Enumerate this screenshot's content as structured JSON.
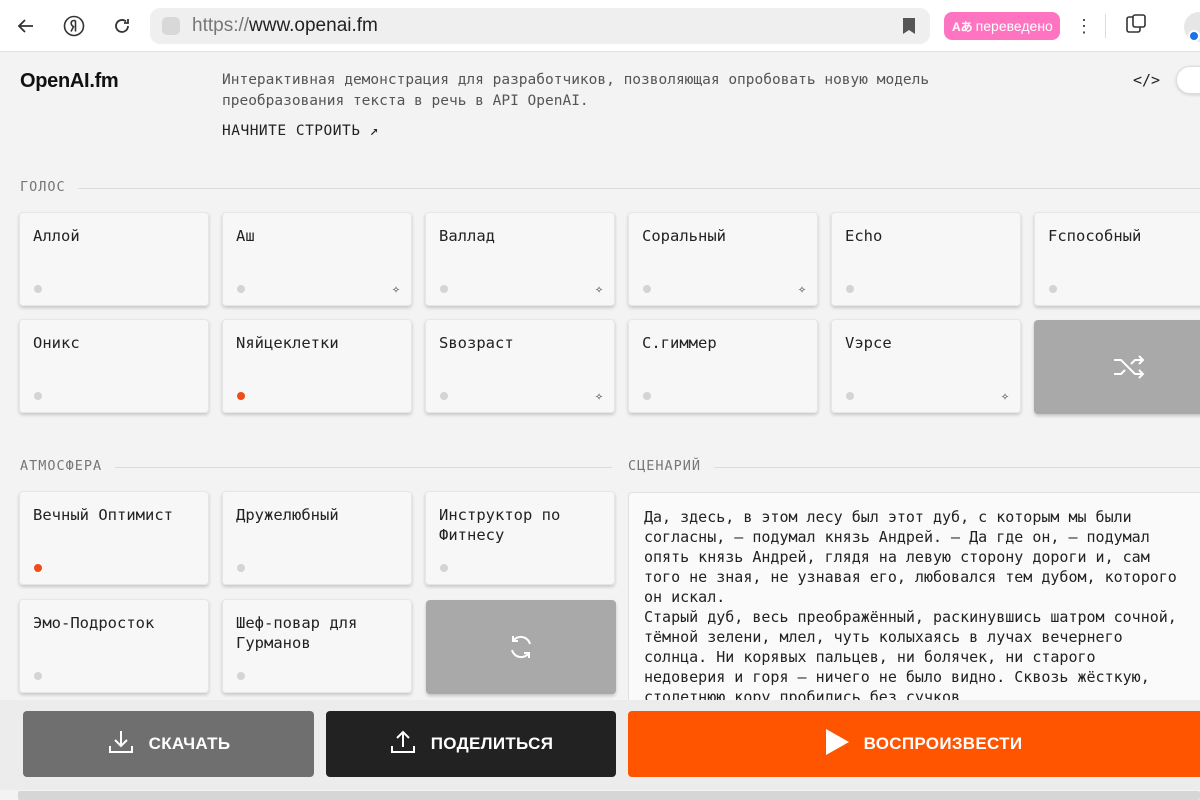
{
  "browser": {
    "url_protocol": "https://",
    "url_host": "www.openai.fm",
    "translated_label": "переведено",
    "more_label": "⋮"
  },
  "header": {
    "logo": "OpenAI.fm",
    "description": "Интерактивная демонстрация для разработчиков, позволяющая опробовать новую модель преобразования текста в речь в API OpenAI.",
    "cta": "НАЧНИТЕ СТРОИТЬ ↗",
    "code_icon": "</>"
  },
  "voice": {
    "label": "ГОЛОС",
    "items": [
      {
        "name": "Аллой",
        "selected": false,
        "new": false
      },
      {
        "name": "Аш",
        "selected": false,
        "new": true
      },
      {
        "name": "Валлад",
        "selected": false,
        "new": true
      },
      {
        "name": "Соральный",
        "selected": false,
        "new": true
      },
      {
        "name": "Echo",
        "selected": false,
        "new": false
      },
      {
        "name": "Fспособный",
        "selected": false,
        "new": false
      },
      {
        "name": "Оникс",
        "selected": false,
        "new": false
      },
      {
        "name": "Nяйцеклетки",
        "selected": true,
        "new": false
      },
      {
        "name": "Sвозраст",
        "selected": false,
        "new": true
      },
      {
        "name": "С.гиммер",
        "selected": false,
        "new": false
      },
      {
        "name": "Vэрсе",
        "selected": false,
        "new": true
      }
    ]
  },
  "vibe": {
    "label": "АТМОСФЕРА",
    "items": [
      {
        "name": "Вечный Оптимист",
        "selected": true
      },
      {
        "name": "Дружелюбный",
        "selected": false
      },
      {
        "name": "Инструктор по Фитнесу",
        "selected": false
      },
      {
        "name": "Эмо-Подросток",
        "selected": false
      },
      {
        "name": "Шеф-повар для Гурманов",
        "selected": false
      }
    ]
  },
  "script": {
    "label": "СЦЕНАРИЙ",
    "text": "Да, здесь, в этом лесу был этот дуб, с которым мы были согласны, — подумал князь Андрей. — Да где он, — подумал опять князь Андрей, глядя на левую сторону дороги и, сам того не зная, не узнавая его, любовался тем дубом, которого он искал.\nСтарый дуб, весь преображённый, раскинувшись шатром сочной, тёмной зелени, млел, чуть колыхаясь в лучах вечернего солнца. Ни корявых пальцев, ни болячек, ни старого недоверия и горя — ничего не было видно. Сквозь жёсткую, столетнюю кору пробились без сучков"
  },
  "actions": {
    "download": "СКАЧАТЬ",
    "share": "ПОДЕЛИТЬСЯ",
    "play": "ВОСПРОИЗВЕСТИ"
  },
  "colors": {
    "accent": "#ff5500",
    "selected_dot": "#ef4c17",
    "translated_badge": "#ff74c0"
  }
}
